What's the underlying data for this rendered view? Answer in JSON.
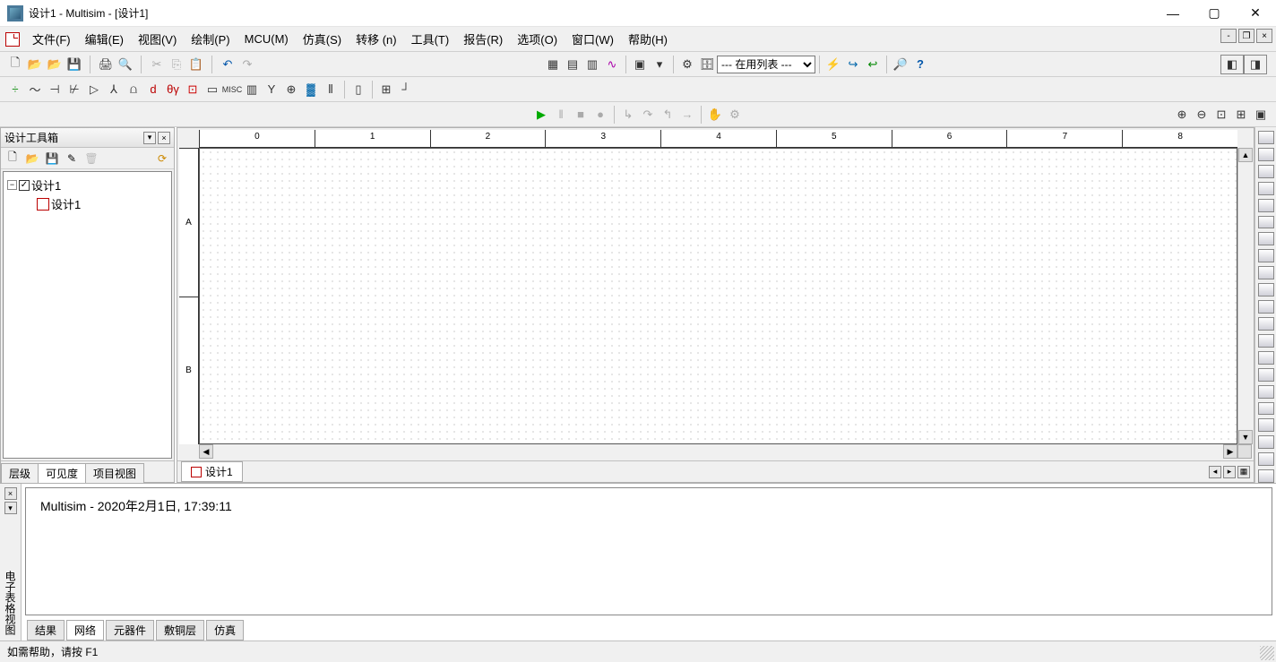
{
  "window": {
    "title": "设计1 - Multisim - [设计1]"
  },
  "menu": {
    "file": "文件(F)",
    "edit": "编辑(E)",
    "view": "视图(V)",
    "draw": "绘制(P)",
    "mcu": "MCU(M)",
    "sim": "仿真(S)",
    "transfer": "转移 (n)",
    "tools": "工具(T)",
    "report": "报告(R)",
    "options": "选项(O)",
    "window": "窗口(W)",
    "help": "帮助(H)"
  },
  "toolbar": {
    "in_use_list": "--- 在用列表 ---"
  },
  "sidebar": {
    "title": "设计工具箱",
    "tree": {
      "root": "设计1",
      "child": "设计1"
    },
    "tabs": {
      "hierarchy": "层级",
      "visibility": "可见度",
      "project": "项目视图"
    }
  },
  "canvas": {
    "ruler_h": [
      "0",
      "1",
      "2",
      "3",
      "4",
      "5",
      "6",
      "7",
      "8"
    ],
    "ruler_v": [
      "A",
      "B"
    ],
    "tab": "设计1"
  },
  "bottom": {
    "side_label": "电子表格视图",
    "message": "Multisim  -  2020年2月1日, 17:39:11",
    "tabs": {
      "results": "结果",
      "network": "网络",
      "components": "元器件",
      "copper": "敷铜层",
      "simulation": "仿真"
    }
  },
  "status": {
    "help": "如需帮助，请按 F1"
  }
}
